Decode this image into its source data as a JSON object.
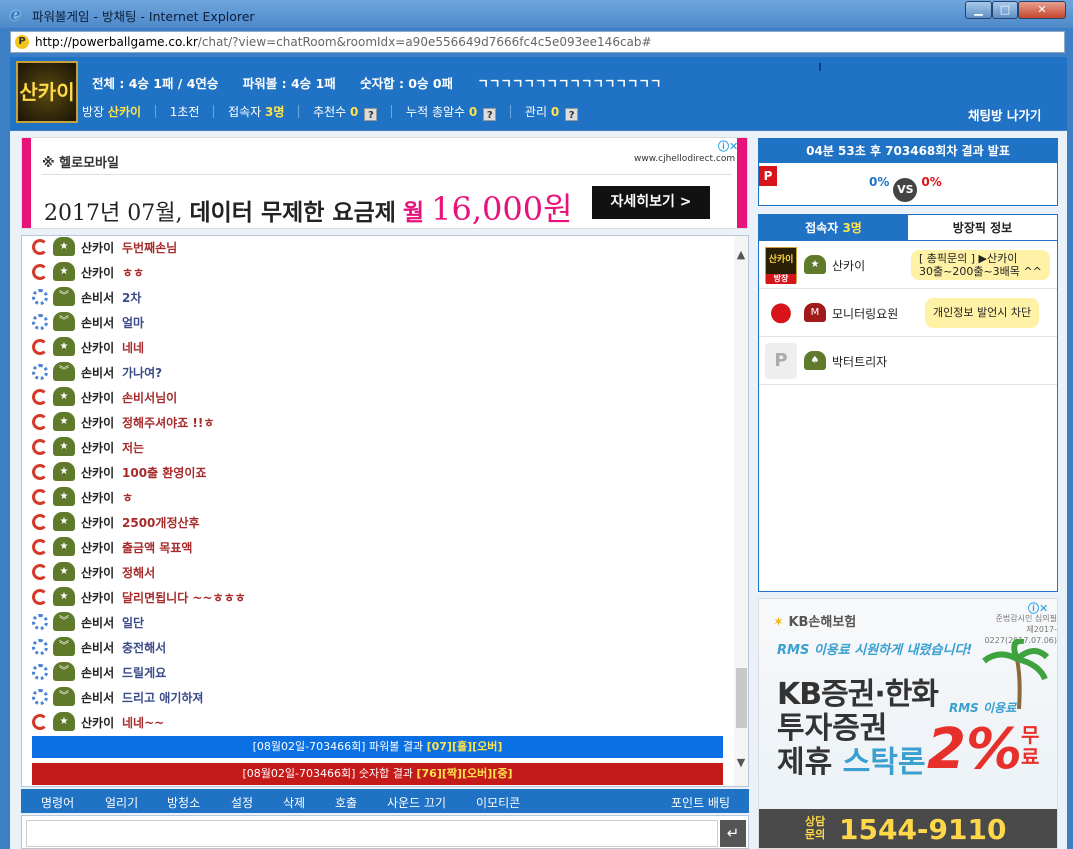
{
  "window": {
    "title": "파워볼게임 - 방채팅 - Internet Explorer",
    "min": "▁",
    "max": "□",
    "close": "✕"
  },
  "address": {
    "host": "http://powerballgame.co.kr",
    "path": "/chat/?view=chatRoom&roomIdx=a90e556649d7666fc4c5e093ee146cab#"
  },
  "header": {
    "logo_text": "산카이",
    "stat_total": "전체 : 4승 1패 / 4연승",
    "stat_powerball": "파워볼 : 4승 1패",
    "stat_sum": "숫자합 : 0승 0패",
    "stat_extra": "ㄱㄱㄱㄱㄱㄱㄱㄱㄱㄱㄱㄱㄱㄱㄱㄱ",
    "host_label": "방장",
    "host_name": "산카이",
    "rank": "1초전",
    "users_label": "접속자",
    "users_count": "3명",
    "recommend_label": "추천수",
    "recommend_count": "0",
    "total_rec_label": "누적 총알수",
    "total_rec_count": "0",
    "manage_label": "관리",
    "manage_count": "0",
    "q": "?",
    "leave": "채팅방 나가기"
  },
  "ad_top": {
    "brand": "※ 헬로모바일",
    "site": "www.cjhellodirect.com",
    "h_prefix": "2017년 07월,",
    "h_main": "데이터 무제한 요금제",
    "h_unit": "월",
    "h_price": "16,000원",
    "cta": "자세히보기 >",
    "adchoice": "ⓘ✕"
  },
  "messages": [
    {
      "nick": "산카이",
      "text": "두번째손님",
      "color": "red"
    },
    {
      "nick": "산카이",
      "text": "ㅎㅎ",
      "color": "red"
    },
    {
      "nick": "손비서",
      "text": "2차",
      "color": "blue"
    },
    {
      "nick": "손비서",
      "text": "얼마",
      "color": "blue"
    },
    {
      "nick": "산카이",
      "text": "네네",
      "color": "red"
    },
    {
      "nick": "손비서",
      "text": "가나여?",
      "color": "blue"
    },
    {
      "nick": "산카이",
      "text": "손비서님이",
      "color": "red"
    },
    {
      "nick": "산카이",
      "text": "정해주셔야죠 !!ㅎ",
      "color": "red"
    },
    {
      "nick": "산카이",
      "text": "저는",
      "color": "red"
    },
    {
      "nick": "산카이",
      "text": "100출 환영이죠",
      "color": "red"
    },
    {
      "nick": "산카이",
      "text": "ㅎ",
      "color": "red"
    },
    {
      "nick": "산카이",
      "text": "2500개정산후",
      "color": "red"
    },
    {
      "nick": "산카이",
      "text": "출금액 목표액",
      "color": "red"
    },
    {
      "nick": "산카이",
      "text": "정해서",
      "color": "red"
    },
    {
      "nick": "산카이",
      "text": "달리면됩니다 ~~ㅎㅎㅎ",
      "color": "red"
    },
    {
      "nick": "손비서",
      "text": "일단",
      "color": "blue"
    },
    {
      "nick": "손비서",
      "text": "충전해서",
      "color": "blue"
    },
    {
      "nick": "손비서",
      "text": "드릴게요",
      "color": "blue"
    },
    {
      "nick": "손비서",
      "text": "드리고 애기하져",
      "color": "blue"
    },
    {
      "nick": "산카이",
      "text": "네네~~",
      "color": "red"
    }
  ],
  "notices": {
    "blue_pre": "[08월02일-703466회] 파워볼 결과",
    "blue_hl": "[07][홀][오버]",
    "red_pre": "[08월02일-703466회] 숫자합 결과",
    "red_hl": "[76][짝][오버][중]"
  },
  "toolbar": {
    "cmd": "명령어",
    "open": "얼리기",
    "ban": "방청소",
    "settings": "설정",
    "delete": "삭제",
    "call": "호출",
    "sound": "사운드 끄기",
    "emoticon": "이모티콘",
    "bet": "포인트 배팅"
  },
  "send": "↵",
  "result": {
    "head": "04분 53초 후 703468회차 결과 발표",
    "left_pct": "0%",
    "vs": "VS",
    "right_pct": "0%",
    "p": "P"
  },
  "users_panel": {
    "tab_users_label": "접속자",
    "tab_users_count": "3명",
    "tab_info": "방장픽 정보",
    "rows": [
      {
        "name": "산카이",
        "bubble_1": "[ 총픽문의 ] ▶산카이",
        "bubble_2": "30출~200출~3배목 ^^",
        "big_text": "산카이",
        "badge": "방장"
      },
      {
        "name": "모니터링요원",
        "bubble_1": "개인정보 발언시 차단",
        "small_text": "M"
      },
      {
        "name": "박터트리자",
        "big_text": "P"
      }
    ]
  },
  "ad_side": {
    "brand": "KB손해보험",
    "fine_1": "준법감시인 심의필",
    "fine_2": "제2017-0227(2017.07.06)",
    "rms": "RMS 이용료 시원하게 내렸습니다!",
    "h1": "KB증권·한화",
    "h2": "투자증권",
    "h3_pre": "제휴",
    "h3_hl": "스탁론",
    "rms2": "RMS 이용료",
    "pct": "2%",
    "free": "무료",
    "call_label": "상담문의",
    "tel": "1544-9110",
    "adchoice": "ⓘ✕"
  }
}
